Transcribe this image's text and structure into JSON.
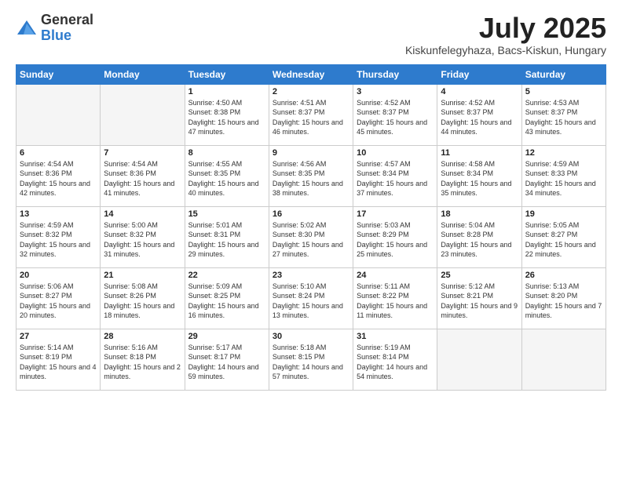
{
  "logo": {
    "general": "General",
    "blue": "Blue"
  },
  "header": {
    "month": "July 2025",
    "location": "Kiskunfelegyhaza, Bacs-Kiskun, Hungary"
  },
  "days_of_week": [
    "Sunday",
    "Monday",
    "Tuesday",
    "Wednesday",
    "Thursday",
    "Friday",
    "Saturday"
  ],
  "weeks": [
    [
      {
        "day": "",
        "sunrise": "",
        "sunset": "",
        "daylight": ""
      },
      {
        "day": "",
        "sunrise": "",
        "sunset": "",
        "daylight": ""
      },
      {
        "day": "1",
        "sunrise": "Sunrise: 4:50 AM",
        "sunset": "Sunset: 8:38 PM",
        "daylight": "Daylight: 15 hours and 47 minutes."
      },
      {
        "day": "2",
        "sunrise": "Sunrise: 4:51 AM",
        "sunset": "Sunset: 8:37 PM",
        "daylight": "Daylight: 15 hours and 46 minutes."
      },
      {
        "day": "3",
        "sunrise": "Sunrise: 4:52 AM",
        "sunset": "Sunset: 8:37 PM",
        "daylight": "Daylight: 15 hours and 45 minutes."
      },
      {
        "day": "4",
        "sunrise": "Sunrise: 4:52 AM",
        "sunset": "Sunset: 8:37 PM",
        "daylight": "Daylight: 15 hours and 44 minutes."
      },
      {
        "day": "5",
        "sunrise": "Sunrise: 4:53 AM",
        "sunset": "Sunset: 8:37 PM",
        "daylight": "Daylight: 15 hours and 43 minutes."
      }
    ],
    [
      {
        "day": "6",
        "sunrise": "Sunrise: 4:54 AM",
        "sunset": "Sunset: 8:36 PM",
        "daylight": "Daylight: 15 hours and 42 minutes."
      },
      {
        "day": "7",
        "sunrise": "Sunrise: 4:54 AM",
        "sunset": "Sunset: 8:36 PM",
        "daylight": "Daylight: 15 hours and 41 minutes."
      },
      {
        "day": "8",
        "sunrise": "Sunrise: 4:55 AM",
        "sunset": "Sunset: 8:35 PM",
        "daylight": "Daylight: 15 hours and 40 minutes."
      },
      {
        "day": "9",
        "sunrise": "Sunrise: 4:56 AM",
        "sunset": "Sunset: 8:35 PM",
        "daylight": "Daylight: 15 hours and 38 minutes."
      },
      {
        "day": "10",
        "sunrise": "Sunrise: 4:57 AM",
        "sunset": "Sunset: 8:34 PM",
        "daylight": "Daylight: 15 hours and 37 minutes."
      },
      {
        "day": "11",
        "sunrise": "Sunrise: 4:58 AM",
        "sunset": "Sunset: 8:34 PM",
        "daylight": "Daylight: 15 hours and 35 minutes."
      },
      {
        "day": "12",
        "sunrise": "Sunrise: 4:59 AM",
        "sunset": "Sunset: 8:33 PM",
        "daylight": "Daylight: 15 hours and 34 minutes."
      }
    ],
    [
      {
        "day": "13",
        "sunrise": "Sunrise: 4:59 AM",
        "sunset": "Sunset: 8:32 PM",
        "daylight": "Daylight: 15 hours and 32 minutes."
      },
      {
        "day": "14",
        "sunrise": "Sunrise: 5:00 AM",
        "sunset": "Sunset: 8:32 PM",
        "daylight": "Daylight: 15 hours and 31 minutes."
      },
      {
        "day": "15",
        "sunrise": "Sunrise: 5:01 AM",
        "sunset": "Sunset: 8:31 PM",
        "daylight": "Daylight: 15 hours and 29 minutes."
      },
      {
        "day": "16",
        "sunrise": "Sunrise: 5:02 AM",
        "sunset": "Sunset: 8:30 PM",
        "daylight": "Daylight: 15 hours and 27 minutes."
      },
      {
        "day": "17",
        "sunrise": "Sunrise: 5:03 AM",
        "sunset": "Sunset: 8:29 PM",
        "daylight": "Daylight: 15 hours and 25 minutes."
      },
      {
        "day": "18",
        "sunrise": "Sunrise: 5:04 AM",
        "sunset": "Sunset: 8:28 PM",
        "daylight": "Daylight: 15 hours and 23 minutes."
      },
      {
        "day": "19",
        "sunrise": "Sunrise: 5:05 AM",
        "sunset": "Sunset: 8:27 PM",
        "daylight": "Daylight: 15 hours and 22 minutes."
      }
    ],
    [
      {
        "day": "20",
        "sunrise": "Sunrise: 5:06 AM",
        "sunset": "Sunset: 8:27 PM",
        "daylight": "Daylight: 15 hours and 20 minutes."
      },
      {
        "day": "21",
        "sunrise": "Sunrise: 5:08 AM",
        "sunset": "Sunset: 8:26 PM",
        "daylight": "Daylight: 15 hours and 18 minutes."
      },
      {
        "day": "22",
        "sunrise": "Sunrise: 5:09 AM",
        "sunset": "Sunset: 8:25 PM",
        "daylight": "Daylight: 15 hours and 16 minutes."
      },
      {
        "day": "23",
        "sunrise": "Sunrise: 5:10 AM",
        "sunset": "Sunset: 8:24 PM",
        "daylight": "Daylight: 15 hours and 13 minutes."
      },
      {
        "day": "24",
        "sunrise": "Sunrise: 5:11 AM",
        "sunset": "Sunset: 8:22 PM",
        "daylight": "Daylight: 15 hours and 11 minutes."
      },
      {
        "day": "25",
        "sunrise": "Sunrise: 5:12 AM",
        "sunset": "Sunset: 8:21 PM",
        "daylight": "Daylight: 15 hours and 9 minutes."
      },
      {
        "day": "26",
        "sunrise": "Sunrise: 5:13 AM",
        "sunset": "Sunset: 8:20 PM",
        "daylight": "Daylight: 15 hours and 7 minutes."
      }
    ],
    [
      {
        "day": "27",
        "sunrise": "Sunrise: 5:14 AM",
        "sunset": "Sunset: 8:19 PM",
        "daylight": "Daylight: 15 hours and 4 minutes."
      },
      {
        "day": "28",
        "sunrise": "Sunrise: 5:16 AM",
        "sunset": "Sunset: 8:18 PM",
        "daylight": "Daylight: 15 hours and 2 minutes."
      },
      {
        "day": "29",
        "sunrise": "Sunrise: 5:17 AM",
        "sunset": "Sunset: 8:17 PM",
        "daylight": "Daylight: 14 hours and 59 minutes."
      },
      {
        "day": "30",
        "sunrise": "Sunrise: 5:18 AM",
        "sunset": "Sunset: 8:15 PM",
        "daylight": "Daylight: 14 hours and 57 minutes."
      },
      {
        "day": "31",
        "sunrise": "Sunrise: 5:19 AM",
        "sunset": "Sunset: 8:14 PM",
        "daylight": "Daylight: 14 hours and 54 minutes."
      },
      {
        "day": "",
        "sunrise": "",
        "sunset": "",
        "daylight": ""
      },
      {
        "day": "",
        "sunrise": "",
        "sunset": "",
        "daylight": ""
      }
    ]
  ]
}
